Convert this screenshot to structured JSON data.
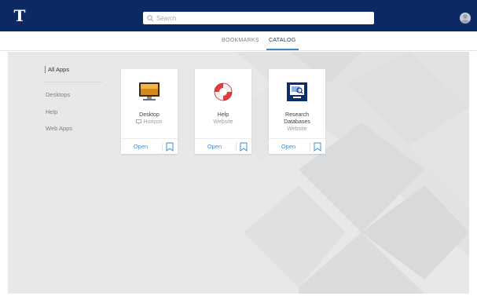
{
  "header": {
    "logo_icon": "university-t-logo",
    "search": {
      "placeholder": "Search",
      "icon": "search-icon"
    },
    "avatar_icon": "user-avatar"
  },
  "tabs": [
    {
      "label": "BOOKMARKS",
      "active": false
    },
    {
      "label": "CATALOG",
      "active": true
    }
  ],
  "sidebar": {
    "items": [
      {
        "label": "All Apps",
        "active": true
      },
      {
        "label": "Desktops",
        "active": false
      },
      {
        "label": "Help",
        "active": false
      },
      {
        "label": "Web Apps",
        "active": false
      }
    ]
  },
  "apps": [
    {
      "title": "Desktop",
      "subtitle": "Horizon",
      "subtitle_icon": "monitor-icon",
      "icon": "desktop-monitor-icon",
      "open_label": "Open"
    },
    {
      "title": "Help",
      "subtitle": "Website",
      "icon": "lifebuoy-icon",
      "open_label": "Open"
    },
    {
      "title_lines": [
        "Research",
        "Databases"
      ],
      "subtitle": "Website",
      "icon": "research-databases-icon",
      "open_label": "Open"
    }
  ],
  "colors": {
    "header_bg": "#0b2a63",
    "accent": "#3e8fd6",
    "main_bg": "#e9e9ea"
  }
}
